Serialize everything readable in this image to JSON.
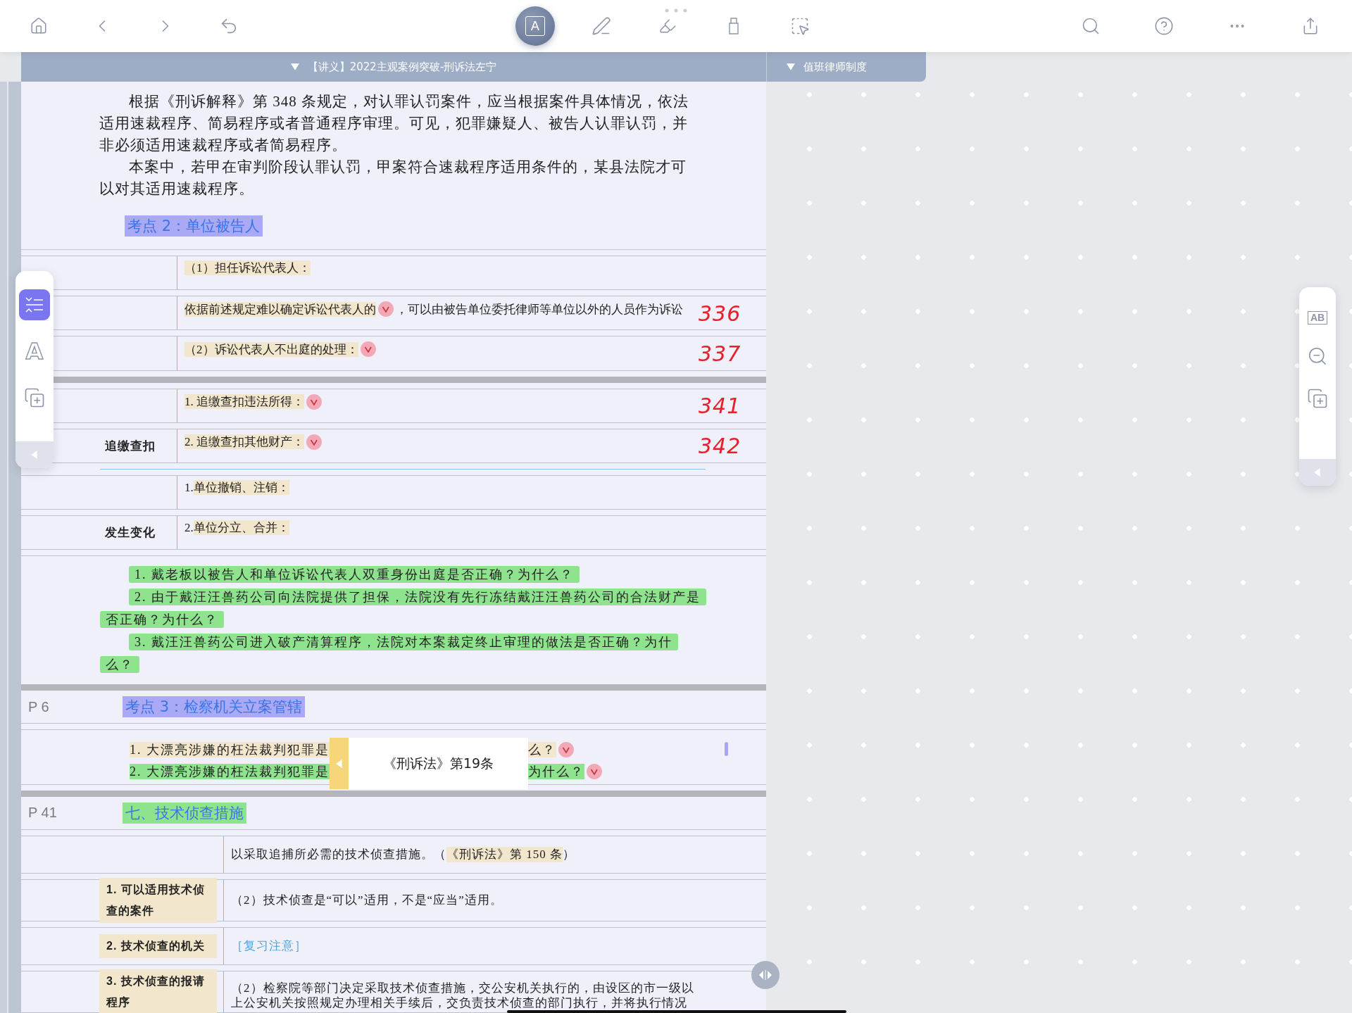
{
  "toolbar": {
    "tools": [
      {
        "kind": "text",
        "glyph": "A",
        "selected": true
      },
      {
        "kind": "pen",
        "selected": false
      },
      {
        "kind": "highlighter",
        "selected": false
      },
      {
        "kind": "marker",
        "selected": false
      },
      {
        "kind": "lasso",
        "selected": false
      }
    ]
  },
  "doc_tabs": [
    {
      "label": "【讲义】2022主观案例突破-刑诉法左宁",
      "expanded": true
    },
    {
      "label": "值班律师制度",
      "expanded": true
    }
  ],
  "side_tools": [
    {
      "kind": "outline",
      "selected": true
    },
    {
      "kind": "text",
      "glyph": "A",
      "selected": false
    },
    {
      "kind": "add_page",
      "selected": false
    }
  ],
  "right_tools": [
    {
      "kind": "ocr",
      "glyph": "AB"
    },
    {
      "kind": "zoom_out"
    },
    {
      "kind": "add_page"
    }
  ],
  "blocks": [
    {
      "kind": "intro",
      "paragraphs": [
        "根据《刑诉解释》第 348 条规定，对认罪认罚案件，应当根据案件具体情况，依法适用速裁程序、简易程序或者普通程序审理。可见，犯罪嫌疑人、被告人认罪认罚，并非必须适用速裁程序或者简易程序。",
        "本案中，若甲在审判阶段认罪认罚，甲案符合速裁程序适用条件的，某县法院才可以对其适用速裁程序。"
      ],
      "heading": {
        "text": "考点 2：单位被告人",
        "color": "#aaa9f5"
      }
    },
    {
      "kind": "row",
      "lines": [
        {
          "segments": [
            {
              "text": "（1）担任诉讼代表人：",
              "color": "#f2e6cc",
              "check": false
            }
          ]
        }
      ]
    },
    {
      "kind": "row",
      "lines": [
        {
          "segments": [
            {
              "text": "依据前述规定难以确定诉讼代表人的",
              "color": "#f2e6cc",
              "check": true
            },
            {
              "text": "，可以由被告单位委托律师等单位以外的人员作为诉讼",
              "check": false
            }
          ]
        }
      ],
      "note": "336"
    },
    {
      "kind": "row",
      "lines": [
        {
          "segments": [
            {
              "text": "（2）诉讼代表人不出庭的处理：",
              "color": "#f2e6cc",
              "check": true
            }
          ]
        }
      ],
      "note": "337"
    },
    {
      "kind": "bar"
    },
    {
      "kind": "row",
      "lines": [
        {
          "segments": [
            {
              "text": "1. 追缴查扣违法所得：",
              "color": "#f2e6cc",
              "check": true
            }
          ]
        }
      ],
      "note": "341"
    },
    {
      "kind": "row",
      "label": {
        "text": "追缴查扣"
      },
      "lines": [
        {
          "segments": [
            {
              "text": "2. 追缴查扣其他财产：",
              "color": "#f2e6cc",
              "check": true
            }
          ]
        }
      ],
      "note": "342"
    },
    {
      "kind": "rule"
    },
    {
      "kind": "row",
      "lines": [
        {
          "segments": [
            {
              "text": "1. ",
              "check": false
            },
            {
              "text": "单位撤销、注销：",
              "color": "#f2e6cc",
              "check": false
            }
          ]
        }
      ]
    },
    {
      "kind": "row",
      "label": {
        "text": "发生变化"
      },
      "lines": [
        {
          "segments": [
            {
              "text": "2. ",
              "check": false
            },
            {
              "text": "单位分立、合并：",
              "color": "#f2e6cc",
              "check": false
            }
          ]
        }
      ]
    },
    {
      "kind": "questions",
      "items": [
        {
          "text": "1. 戴老板以被告人和单位诉讼代表人双重身份出庭是否正确？为什么？",
          "color": "#8fe38f"
        },
        {
          "text": "2. 由于戴汪汪兽药公司向法院提供了担保，法院没有先行冻结戴汪汪兽药公司的合法财产是否正确？为什么？",
          "color": "#8fe38f"
        },
        {
          "text": "3. 戴汪汪兽药公司进入破产清算程序，法院对本案裁定终止审理的做法是否正确？为什么？",
          "color": "#8fe38f"
        }
      ]
    },
    {
      "kind": "bar"
    },
    {
      "kind": "page",
      "page": "P 6",
      "heading": {
        "text": "考点 3：检察机关立案管辖",
        "color": "#aaa9f5"
      },
      "rows": [
        {
          "kind": "popup_strip",
          "popup": "《刑诉法》第19条",
          "lines": [
            {
              "segments": [
                {
                  "text": "1. 大漂亮涉嫌的枉法裁判犯罪是",
                  "color": "#f2e6cc",
                  "check": false
                },
                {
                  "text": "么？",
                  "color": "#f2e6cc",
                  "check": true
                }
              ]
            },
            {
              "segments": [
                {
                  "text": "2. 大漂亮涉嫌的枉法裁判犯罪是",
                  "color": "#8fe38f",
                  "check": false
                },
                {
                  "text": "为什么？",
                  "color": "#8fe38f",
                  "check": true
                }
              ]
            }
          ]
        }
      ]
    },
    {
      "kind": "bar"
    },
    {
      "kind": "page",
      "page": "P 41",
      "heading": {
        "text": "七、技术侦查措施",
        "color": "#8fe38f"
      },
      "rows": [
        {
          "kind": "row",
          "lines": [
            {
              "segments": [
                {
                  "text": "以采取追捕所必需的技术侦查措施。（",
                  "check": false
                },
                {
                  "text": "《刑诉法》第 150 条",
                  "color": "#f2e6cc",
                  "check": false
                },
                {
                  "text": "）",
                  "check": false
                }
              ]
            }
          ]
        },
        {
          "kind": "row",
          "label": {
            "text": "1. 可以适用技术侦查的案件",
            "color": "#f2e6cc"
          },
          "lines": [
            {
              "segments": [
                {
                  "text": "（2）技术侦查是“可以”适用，不是“应当”适用。",
                  "check": false
                }
              ]
            }
          ]
        },
        {
          "kind": "row",
          "label": {
            "text": "2. 技术侦查的机关",
            "color": "#f2e6cc"
          },
          "lines": [
            {
              "tag": "［复习注意］"
            }
          ]
        },
        {
          "kind": "row",
          "label": {
            "text": "3. 技术侦查的报请程序",
            "color": "#f2e6cc"
          },
          "lines": [
            {
              "segments": [
                {
                  "text": "（2）检察院等部门决定采取技术侦查措施，交公安机关执行的，由设区的市一级以",
                  "check": false
                }
              ]
            },
            {
              "segments": [
                {
                  "text": "上公安机关按照规定办理相关手续后，交负责技术侦查的部门执行，并将执行情况",
                  "check": false
                }
              ]
            }
          ]
        }
      ]
    }
  ]
}
